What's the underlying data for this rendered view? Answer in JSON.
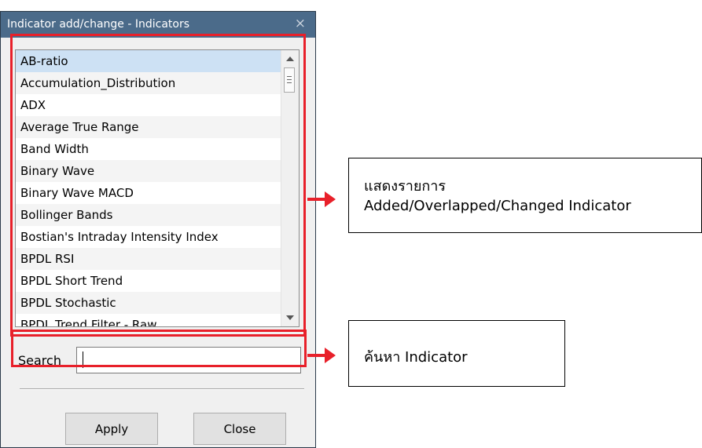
{
  "dialog": {
    "title": "Indicator add/change - Indicators",
    "close_glyph": "×"
  },
  "indicator_list": {
    "selected_index": 0,
    "items": [
      "AB-ratio",
      "Accumulation_Distribution",
      "ADX",
      "Average True Range",
      "Band Width",
      "Binary Wave",
      "Binary Wave MACD",
      "Bollinger Bands",
      "Bostian's Intraday Intensity Index",
      "BPDL RSI",
      "BPDL Short Trend",
      "BPDL Stochastic",
      "BPDL Trend Filter - Raw"
    ]
  },
  "search": {
    "label": "Search",
    "value": ""
  },
  "buttons": {
    "apply": "Apply",
    "close": "Close"
  },
  "annotations": {
    "list_callout_line1": "แสดงรายการ",
    "list_callout_line2": "Added/Overlapped/Changed Indicator",
    "search_callout": "ค้นหา Indicator",
    "highlight_color": "#e8202a"
  },
  "icons": {
    "close": "close-icon",
    "scroll_up": "scroll-up-arrow-icon",
    "scroll_down": "scroll-down-arrow-icon",
    "scroll_thumb": "scroll-thumb-grip-icon"
  },
  "colors": {
    "titlebar": "#4b6b8a",
    "selection": "#cde1f4",
    "dialog_bg": "#f0f0f0"
  }
}
